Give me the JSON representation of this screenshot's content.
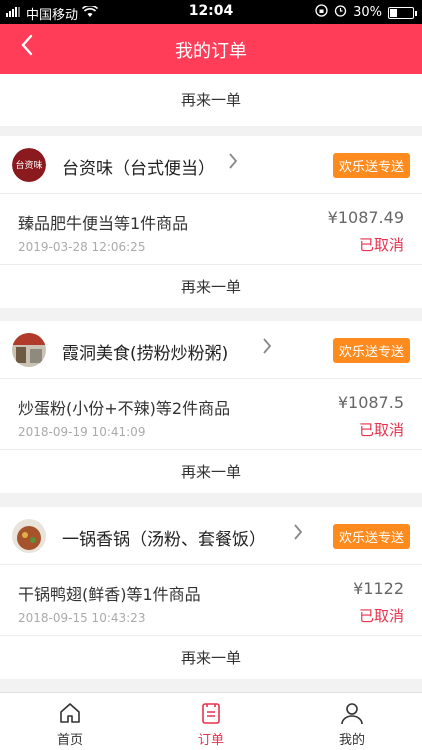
{
  "status_bar": {
    "carrier": "中国移动",
    "time": "12:04",
    "battery": "30%"
  },
  "nav": {
    "back_icon": "chevron-left-icon",
    "title": "我的订单"
  },
  "top_reorder_label": "再来一单",
  "orders": [
    {
      "shop": "台资味（台式便当）",
      "tag": "欢乐送专送",
      "item": "臻品肥牛便当等1件商品",
      "time": "2019-03-28 12:06:25",
      "price": "¥1087.49",
      "status": "已取消",
      "reorder": "再来一单",
      "logo_text": "台资味"
    },
    {
      "shop": "霞洞美食(捞粉炒粉粥)",
      "tag": "欢乐送专送",
      "item": "炒蛋粉(小份+不辣)等2件商品",
      "time": "2018-09-19 10:41:09",
      "price": "¥1087.5",
      "status": "已取消",
      "reorder": "再来一单"
    },
    {
      "shop": "一锅香锅（汤粉、套餐饭）",
      "tag": "欢乐送专送",
      "item": "干锅鸭翅(鲜香)等1件商品",
      "time": "2018-09-15 10:43:23",
      "price": "¥1122",
      "status": "已取消",
      "reorder": "再来一单"
    }
  ],
  "tabs": [
    {
      "label": "首页",
      "icon": "home-icon"
    },
    {
      "label": "订单",
      "icon": "order-icon"
    },
    {
      "label": "我的",
      "icon": "user-icon"
    }
  ],
  "colors": {
    "accent": "#ff3d58",
    "tag": "#ff8a1e",
    "cancelled": "#e8324e"
  }
}
